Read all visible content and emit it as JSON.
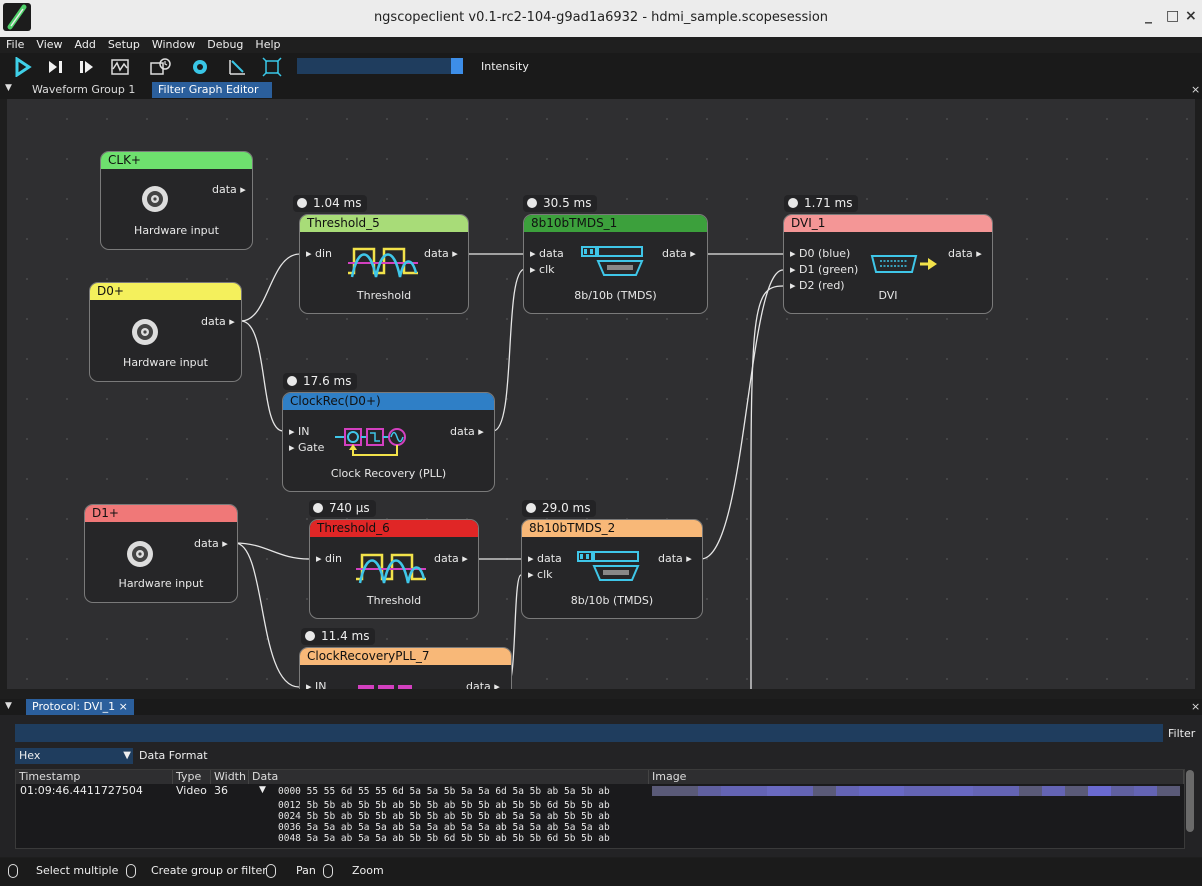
{
  "window": {
    "title": "ngscopeclient v0.1-rc2-104-g9ad1a6932 - hdmi_sample.scopesession",
    "minimize": "_",
    "maximize": "□",
    "close": "×"
  },
  "menu": [
    "File",
    "View",
    "Add",
    "Setup",
    "Window",
    "Debug",
    "Help"
  ],
  "toolbar": {
    "icons": [
      "trigger-start-icon",
      "trigger-single-icon",
      "trigger-force-icon",
      "waveform-icon",
      "history-icon",
      "refresh-icon",
      "clear-sweeps-icon",
      "fullscreen-icon"
    ],
    "intensity_label": "Intensity",
    "intensity": 0.97
  },
  "tabs": {
    "collapse": "▼",
    "waveform_group": "Waveform Group 1",
    "filter_graph": "Filter Graph Editor",
    "close": "×",
    "right_close": "×"
  },
  "nodes": {
    "clk": {
      "title": "CLK+",
      "color": "#6ee06e",
      "label": "Hardware input",
      "out": "data ▸"
    },
    "d0": {
      "title": "D0+",
      "color": "#f4f05c",
      "label": "Hardware input",
      "out": "data ▸"
    },
    "d1": {
      "title": "D1+",
      "color": "#f07878",
      "label": "Hardware input",
      "out": "data ▸"
    },
    "threshold5": {
      "title": "Threshold_5",
      "color": "#a8dc78",
      "timer": "1.04 ms",
      "in": "▸ din",
      "out": "data ▸",
      "label": "Threshold"
    },
    "tmds1": {
      "title": "8b10bTMDS_1",
      "color": "#3ca03c",
      "timer": "30.5 ms",
      "in1": "▸ data",
      "in2": "▸ clk",
      "out": "data ▸",
      "label": "8b/10b (TMDS)"
    },
    "dvi1": {
      "title": "DVI_1",
      "color": "#f49696",
      "timer": "1.71 ms",
      "in1": "▸ D0 (blue)",
      "in2": "▸ D1 (green)",
      "in3": "▸ D2 (red)",
      "out": "data ▸",
      "label": "DVI"
    },
    "clockrec": {
      "title": "ClockRec(D0+)",
      "color": "#2f7fc6",
      "timer": "17.6 ms",
      "in1": "▸ IN",
      "in2": "▸ Gate",
      "out": "data ▸",
      "label": "Clock Recovery (PLL)"
    },
    "threshold6": {
      "title": "Threshold_6",
      "color": "#e02626",
      "timer": "740 µs",
      "in": "▸ din",
      "out": "data ▸",
      "label": "Threshold"
    },
    "tmds2": {
      "title": "8b10bTMDS_2",
      "color": "#f8b878",
      "timer": "29.0 ms",
      "in1": "▸ data",
      "in2": "▸ clk",
      "out": "data ▸",
      "label": "8b/10b (TMDS)"
    },
    "clockpll7": {
      "title": "ClockRecoveryPLL_7",
      "color": "#f8b878",
      "timer": "11.4 ms",
      "in1": "▸ IN",
      "out": "data ▸"
    }
  },
  "protocol": {
    "tab": "Protocol: DVI_1",
    "close": "×",
    "right_close": "×",
    "filter_label": "Filter",
    "format_value": "Hex",
    "format_label": "Data Format",
    "columns": [
      "Timestamp",
      "Type",
      "Width",
      "Data",
      "Image"
    ],
    "row": {
      "timestamp": "01:09:46.4411727504",
      "type": "Video",
      "width": "36",
      "expander": "▼",
      "data_lines": [
        "0000 55 55 6d 55 55 6d 5a 5a 5b 5a 5a 6d 5a 5b ab 5a 5b ab",
        "0012 5b 5b ab 5b 5b ab 5b 5b ab 5b 5b ab 5b 5b 6d 5b 5b ab",
        "0024 5b 5b ab 5b 5b ab 5b 5b ab 5b 5b ab 5a 5a ab 5b 5b ab",
        "0036 5a 5a ab 5a 5a ab 5a 5a ab 5a 5a ab 5a 5a ab 5a 5a ab",
        "0048 5a 5a ab 5a 5a ab 5b 5b 6d 5b 5b ab 5b 5b 6d 5b 5b ab"
      ]
    },
    "image_strip": [
      "#5a5a78",
      "#5a5a78",
      "#6060a0",
      "#6464b4",
      "#6464b4",
      "#6a6ac0",
      "#6464b4",
      "#5a5a78",
      "#6464b4",
      "#6868c4",
      "#6868c4",
      "#6464b4",
      "#6464b4",
      "#6868c0",
      "#6464b4",
      "#6464b4",
      "#5a5a78",
      "#6464b4",
      "#5a5a78",
      "#6a6ad0",
      "#6060a0",
      "#6464b4",
      "#5a5a78"
    ]
  },
  "status": {
    "select": "Select multiple",
    "create": "Create group or filter",
    "pan": "Pan",
    "zoom": "Zoom"
  }
}
